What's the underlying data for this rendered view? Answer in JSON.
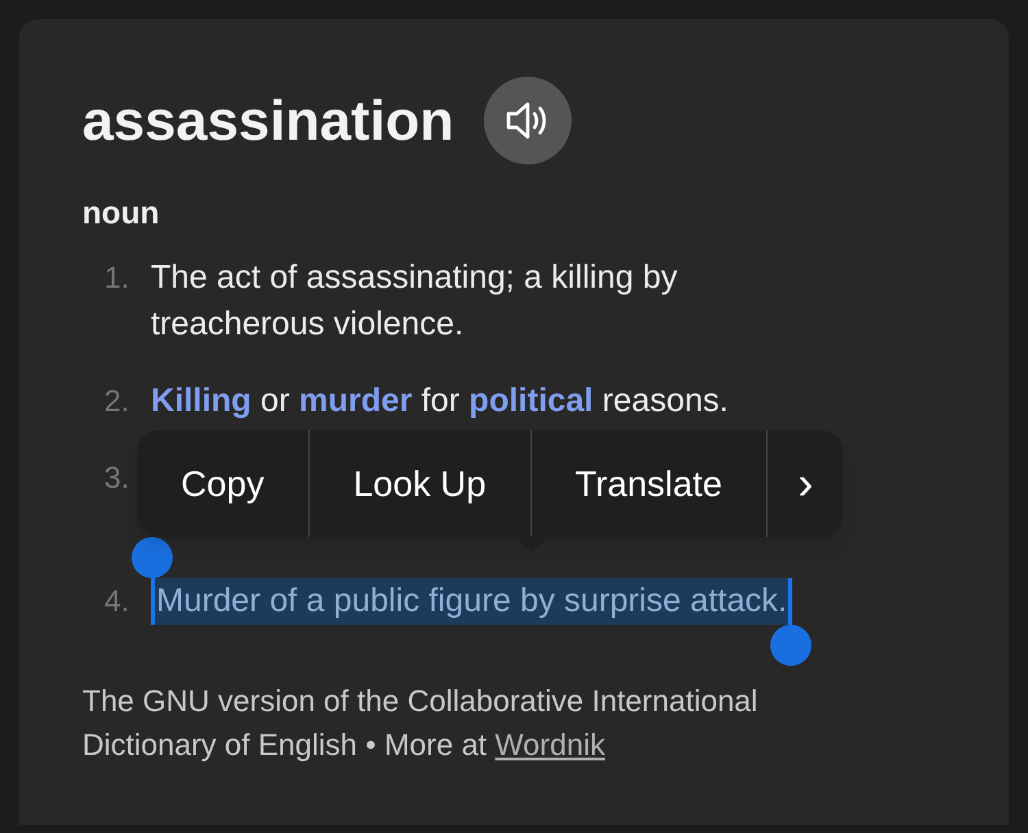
{
  "entry": {
    "word": "assassination",
    "part_of_speech": "noun"
  },
  "definitions": [
    {
      "number": "1.",
      "selected": false,
      "parts": [
        {
          "text": "The act of assassinating; a killing by treacherous violence.",
          "link": false
        }
      ]
    },
    {
      "number": "2.",
      "selected": false,
      "parts": [
        {
          "text": "Killing",
          "link": true
        },
        {
          "text": " or ",
          "link": false
        },
        {
          "text": "murder",
          "link": true
        },
        {
          "text": " for ",
          "link": false
        },
        {
          "text": "political",
          "link": true
        },
        {
          "text": " reasons.",
          "link": false
        }
      ]
    },
    {
      "number": "3.",
      "selected": false
    },
    {
      "number": "4.",
      "selected": true,
      "parts": [
        {
          "text": "Murder of a public figure by surprise attack.",
          "link": false
        }
      ]
    }
  ],
  "context_menu": {
    "items": [
      "Copy",
      "Look Up",
      "Translate"
    ],
    "more": "›"
  },
  "source": {
    "text": "The GNU version of the Collaborative International Dictionary of English",
    "separator": "•",
    "more_label": "More at",
    "link": "Wordnik"
  }
}
